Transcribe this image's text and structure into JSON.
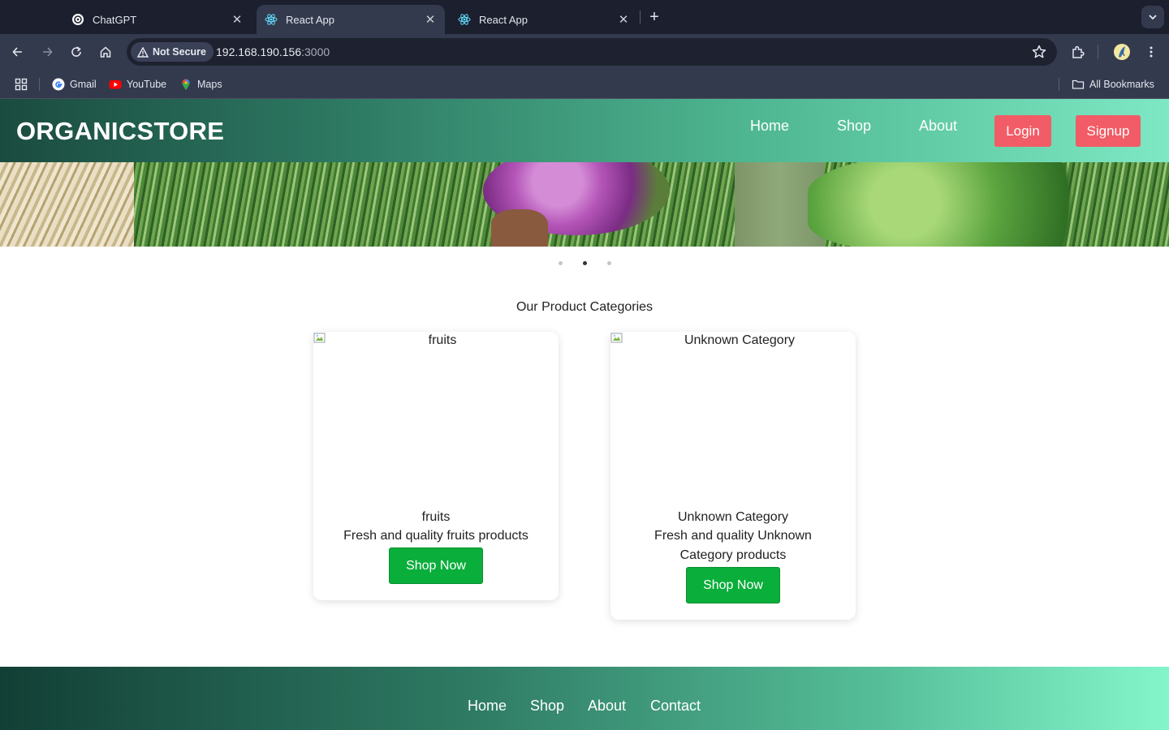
{
  "browser": {
    "tabs": [
      {
        "title": "ChatGPT",
        "icon": "chatgpt-icon",
        "active": false
      },
      {
        "title": "React App",
        "icon": "react-icon",
        "active": true
      },
      {
        "title": "React App",
        "icon": "react-icon",
        "active": false
      }
    ],
    "security_label": "Not Secure",
    "url_host": "192.168.190.156",
    "url_port": ":3000",
    "bookmarks": [
      {
        "label": "Gmail",
        "icon": "google-icon"
      },
      {
        "label": "YouTube",
        "icon": "youtube-icon"
      },
      {
        "label": "Maps",
        "icon": "maps-icon"
      }
    ],
    "all_bookmarks_label": "All Bookmarks"
  },
  "site": {
    "logo": "ORGANICSTORE",
    "nav": {
      "links": [
        "Home",
        "Shop",
        "About"
      ],
      "login_label": "Login",
      "signup_label": "Signup"
    },
    "carousel": {
      "slide_count": 3,
      "active_index": 1
    },
    "categories_title": "Our Product Categories",
    "categories": [
      {
        "alt": "fruits",
        "name": "fruits",
        "description": "Fresh and quality fruits products",
        "button": "Shop Now"
      },
      {
        "alt": "Unknown Category",
        "name": "Unknown Category",
        "description": "Fresh and quality Unknown Category products",
        "button": "Shop Now"
      }
    ],
    "footer_links": [
      "Home",
      "Shop",
      "About",
      "Contact"
    ]
  },
  "colors": {
    "button_red": "#f25c66",
    "button_green": "#0aae3b",
    "nav_gradient_start": "#1a4b3f",
    "nav_gradient_end": "#7de8c3"
  }
}
